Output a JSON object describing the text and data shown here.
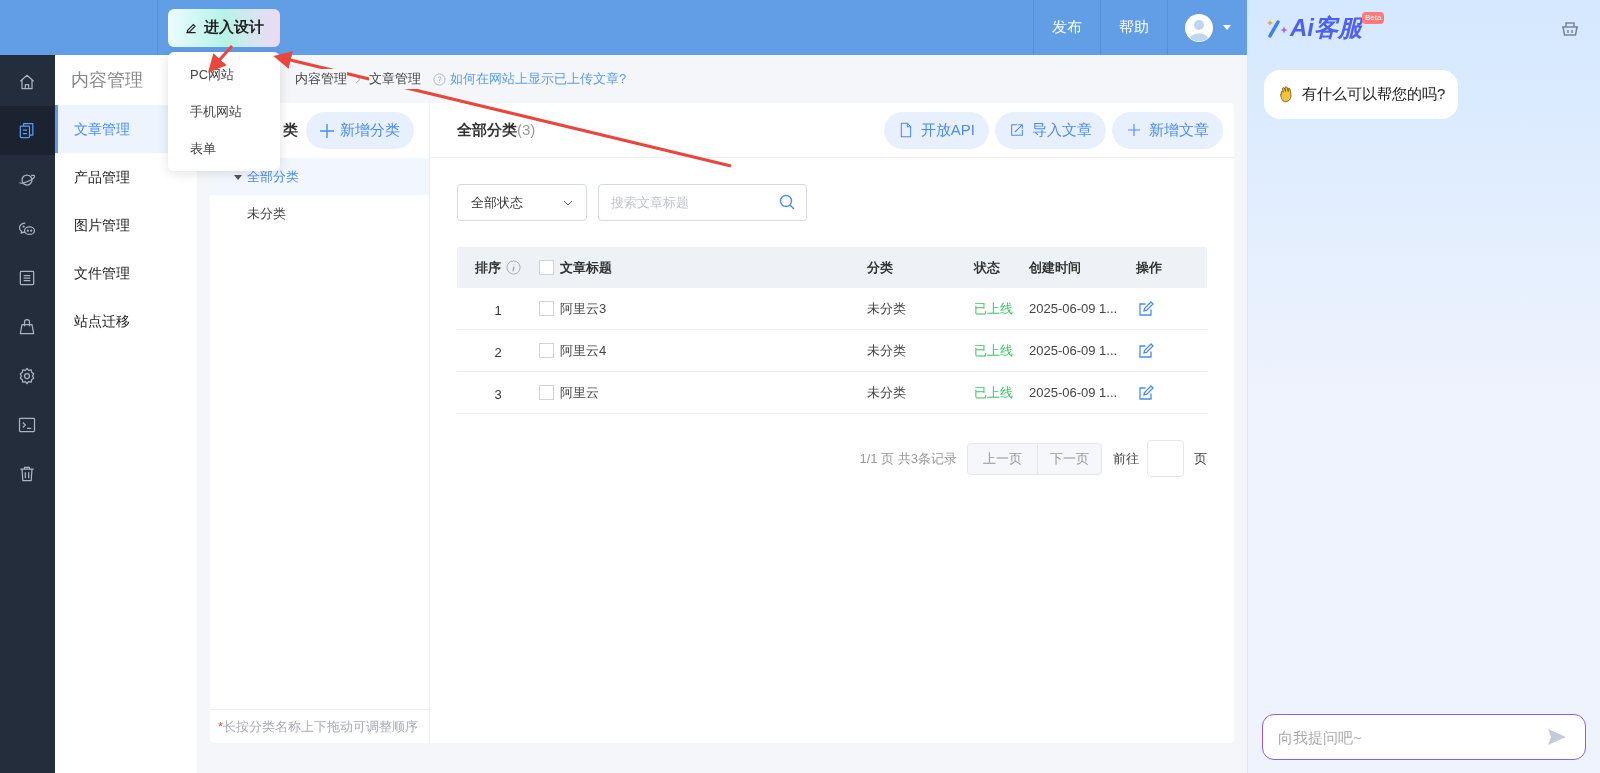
{
  "topbar": {
    "design_button": "进入设计",
    "design_menu": [
      {
        "label": "PC网站"
      },
      {
        "label": "手机网站"
      },
      {
        "label": "表单"
      }
    ],
    "actions": [
      {
        "label": "发布"
      },
      {
        "label": "帮助"
      }
    ]
  },
  "rail": [
    {
      "kind": "home",
      "selected": false
    },
    {
      "kind": "articles",
      "selected": true
    },
    {
      "kind": "planet",
      "selected": false
    },
    {
      "kind": "chat",
      "selected": false
    },
    {
      "kind": "list",
      "selected": false
    },
    {
      "kind": "bag",
      "selected": false
    },
    {
      "kind": "settings",
      "selected": false
    },
    {
      "kind": "terminal",
      "selected": false
    },
    {
      "kind": "trash",
      "selected": false
    }
  ],
  "nav": {
    "title": "内容管理",
    "items": [
      {
        "label": "文章管理",
        "selected": true
      },
      {
        "label": "产品管理",
        "selected": false
      },
      {
        "label": "图片管理",
        "selected": false
      },
      {
        "label": "文件管理",
        "selected": false
      },
      {
        "label": "站点迁移",
        "selected": false
      }
    ]
  },
  "breadcrumb": {
    "items": [
      "内容管理",
      "文章管理"
    ],
    "help_link": "如何在网站上显示已上传文章?"
  },
  "categories": {
    "header": "类",
    "add_button": "新增分类",
    "tree": [
      {
        "label": "全部分类",
        "selected": true,
        "expanded": true
      },
      {
        "label": "未分类",
        "selected": false
      }
    ],
    "note_mark": "*",
    "note": "长按分类名称上下拖动可调整顺序"
  },
  "articles": {
    "title": "全部分类",
    "count": "(3)",
    "buttons": [
      {
        "label": "开放API",
        "kind": "api"
      },
      {
        "label": "导入文章",
        "kind": "import"
      },
      {
        "label": "新增文章",
        "kind": "add"
      }
    ],
    "status_filter": "全部状态",
    "search_placeholder": "搜索文章标题",
    "columns": [
      "排序",
      "文章标题",
      "分类",
      "状态",
      "创建时间",
      "操作"
    ],
    "header_checked": false,
    "rows": [
      {
        "order": "1",
        "title": "阿里云3",
        "category": "未分类",
        "status": "已上线",
        "created": "2025-06-09 1...",
        "checked": false
      },
      {
        "order": "2",
        "title": "阿里云4",
        "category": "未分类",
        "status": "已上线",
        "created": "2025-06-09 1...",
        "checked": false
      },
      {
        "order": "3",
        "title": "阿里云",
        "category": "未分类",
        "status": "已上线",
        "created": "2025-06-09 1...",
        "checked": false
      }
    ],
    "pagination": {
      "summary": "1/1 页 共3条记录",
      "prev": "上一页",
      "next": "下一页",
      "goto": "前往",
      "unit": "页"
    }
  },
  "assistant": {
    "logo": "Ai客服",
    "badge": "Beta",
    "greeting": "有什么可以帮您的吗?",
    "input_placeholder": "向我提问吧~"
  }
}
